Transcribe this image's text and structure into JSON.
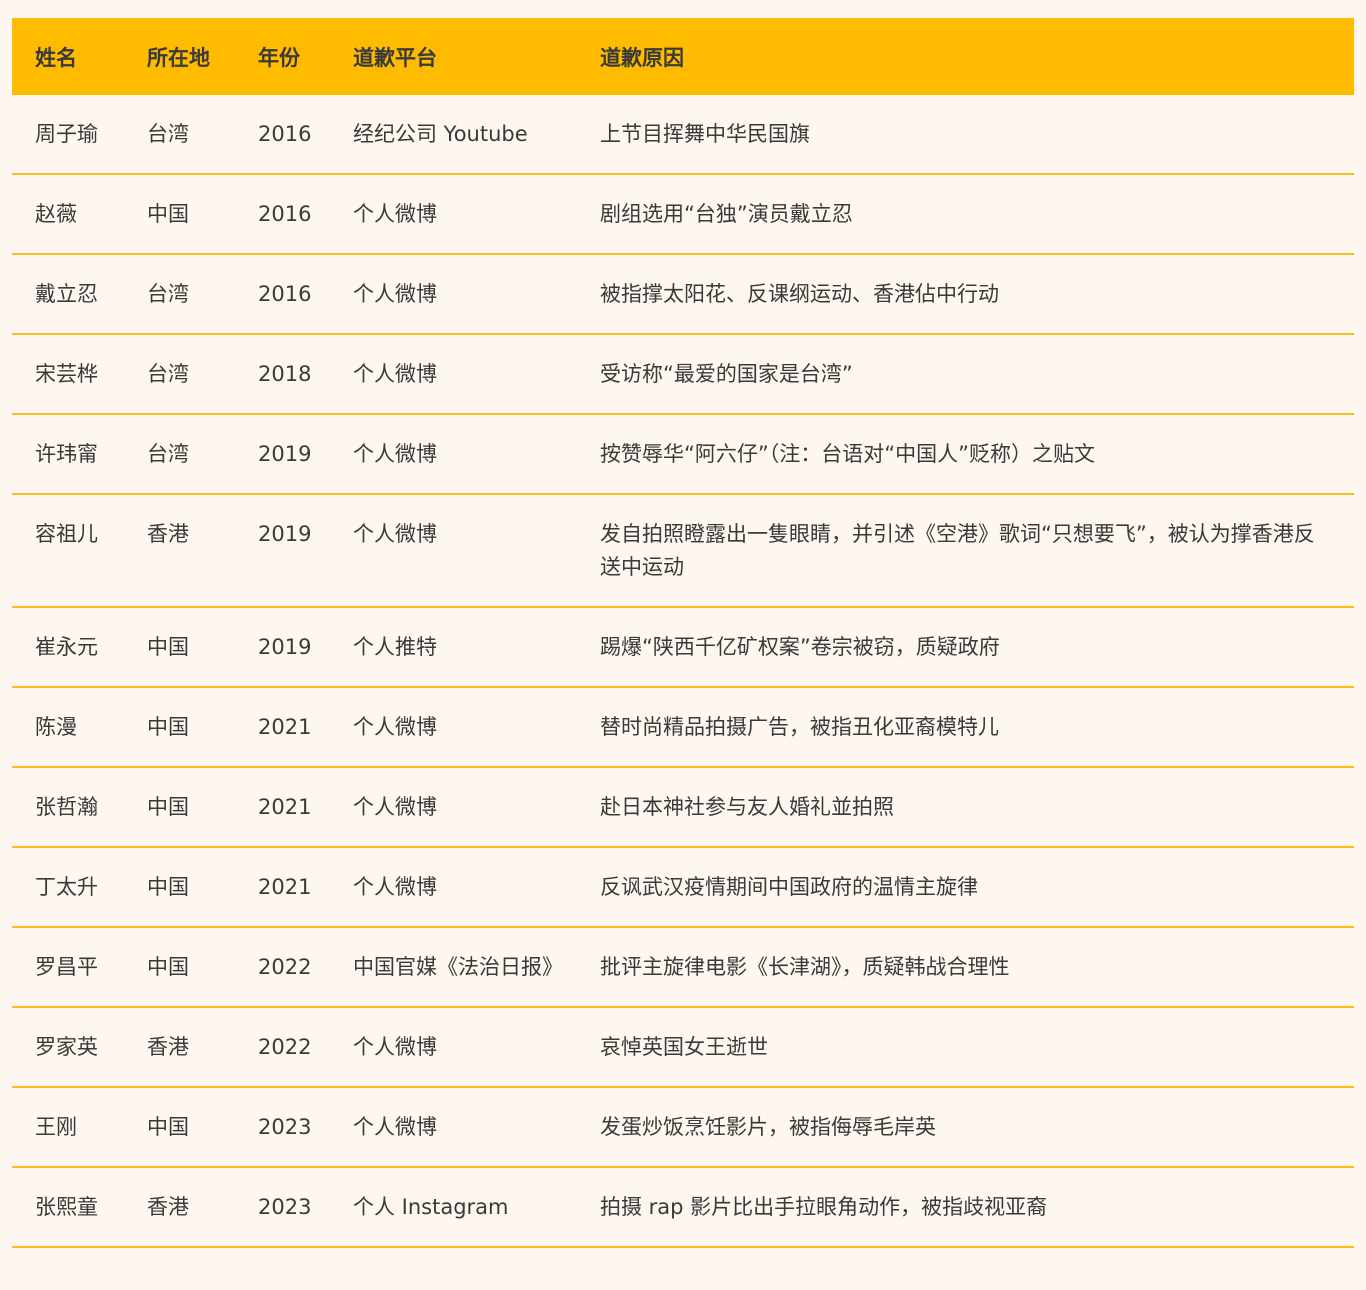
{
  "table": {
    "headers": [
      "姓名",
      "所在地",
      "年份",
      "道歉平台",
      "道歉原因"
    ],
    "rows": [
      [
        "周子瑜",
        "台湾",
        "2016",
        "经纪公司 Youtube",
        "上节目挥舞中华民国旗"
      ],
      [
        "赵薇",
        "中国",
        "2016",
        "个人微博",
        "剧组选用“台独”演员戴立忍"
      ],
      [
        "戴立忍",
        "台湾",
        "2016",
        "个人微博",
        "被指撑太阳花、反课纲运动、香港佔中行动"
      ],
      [
        "宋芸桦",
        "台湾",
        "2018",
        "个人微博",
        "受访称“最爱的国家是台湾”"
      ],
      [
        "许玮甯",
        "台湾",
        "2019",
        "个人微博",
        "按赞辱华“阿六仔”（注：台语对“中国人”贬称）之贴文"
      ],
      [
        "容祖儿",
        "香港",
        "2019",
        "个人微博",
        "发自拍照瞪露出一隻眼睛，并引述《空港》歌词“只想要飞”，被认为撑香港反送中运动"
      ],
      [
        "崔永元",
        "中国",
        "2019",
        "个人推特",
        "踢爆“陕西千亿矿权案”卷宗被窃，质疑政府"
      ],
      [
        "陈漫",
        "中国",
        "2021",
        "个人微博",
        "替时尚精品拍摄广告，被指丑化亚裔模特儿"
      ],
      [
        "张哲瀚",
        "中国",
        "2021",
        "个人微博",
        "赴日本神社参与友人婚礼並拍照"
      ],
      [
        "丁太升",
        "中国",
        "2021",
        "个人微博",
        "反讽武汉疫情期间中国政府的温情主旋律"
      ],
      [
        "罗昌平",
        "中国",
        "2022",
        "中国官媒《法治日报》",
        "批评主旋律电影《长津湖》，质疑韩战合理性"
      ],
      [
        "罗家英",
        "香港",
        "2022",
        "个人微博",
        "哀悼英国女王逝世"
      ],
      [
        "王刚",
        "中国",
        "2023",
        "个人微博",
        "发蛋炒饭烹饪影片，被指侮辱毛岸英"
      ],
      [
        "张熙童",
        "香港",
        "2023",
        "个人 Instagram",
        "拍摄 rap 影片比出手拉眼角动作，被指歧视亚裔"
      ]
    ]
  },
  "colors": {
    "header_bg": "#ffbb00",
    "row_divider": "#f5bd1f",
    "page_bg": "#fdf7ef",
    "text": "#3a3a3a"
  }
}
